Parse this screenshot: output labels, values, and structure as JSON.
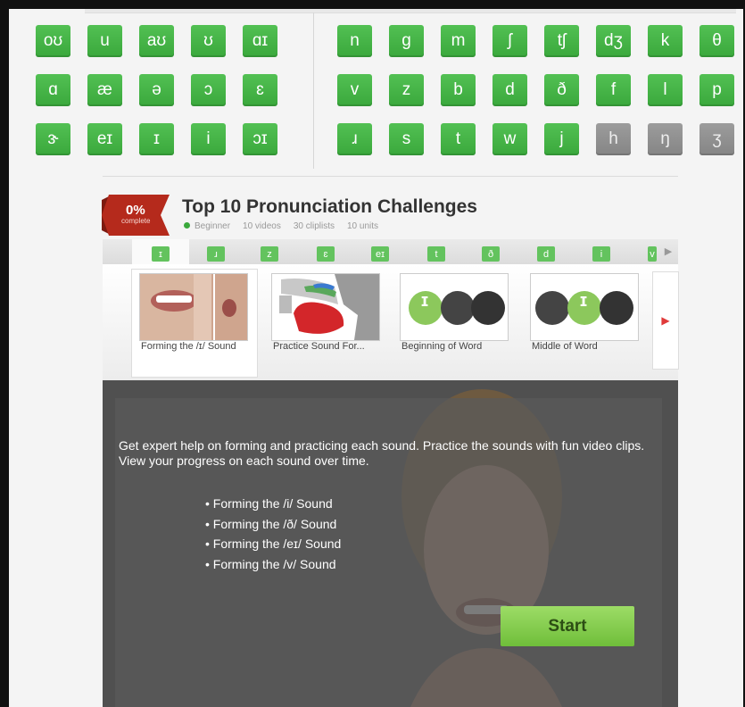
{
  "phonemes": {
    "vowels": [
      [
        "oʊ",
        "u",
        "aʊ",
        "ʊ",
        "ɑɪ"
      ],
      [
        "ɑ",
        "æ",
        "ə",
        "ɔ",
        "ɛ"
      ],
      [
        "ɝ",
        "eɪ",
        "ɪ",
        "i",
        "ɔɪ"
      ]
    ],
    "consonants": [
      [
        "n",
        "g",
        "m",
        "ʃ",
        "tʃ",
        "dʒ",
        "k",
        "θ"
      ],
      [
        "v",
        "z",
        "b",
        "d",
        "ð",
        "f",
        "l",
        "p"
      ],
      [
        "ɹ",
        "s",
        "t",
        "w",
        "j",
        "h",
        "ŋ",
        "ʒ"
      ]
    ],
    "disabled": [
      "h",
      "ŋ",
      "ʒ"
    ]
  },
  "course": {
    "progress_pct": "0%",
    "progress_label": "complete",
    "title": "Top 10 Pronunciation Challenges",
    "level": "Beginner",
    "videos": "10 videos",
    "cliplists": "30 cliplists",
    "units": "10 units"
  },
  "sound_tabs": [
    "ɪ",
    "ɹ",
    "z",
    "ɛ",
    "eɪ",
    "t",
    "ð",
    "d",
    "i",
    "v"
  ],
  "thumbnails": [
    {
      "label": "Forming the /ɪ/ Sound"
    },
    {
      "label": "Practice Sound For..."
    },
    {
      "label": "Beginning of Word"
    },
    {
      "label": "Middle of Word"
    }
  ],
  "thumb_icons": {
    "beginning": [
      "ɪ"
    ],
    "middle": [
      "ɪ"
    ]
  },
  "video": {
    "description": "Get expert help on forming and practicing each sound. Practice the sounds with fun video clips. View your progress on each sound over time.",
    "bullets": [
      "Forming the /i/ Sound",
      "Forming the /ð/ Sound",
      "Forming the /eɪ/ Sound",
      "Forming the /v/ Sound"
    ],
    "start_label": "Start"
  },
  "colors": {
    "key_green": "#3aa83c",
    "key_gray": "#858585",
    "badge_red": "#b52a1c",
    "start_green": "#7cc843"
  }
}
